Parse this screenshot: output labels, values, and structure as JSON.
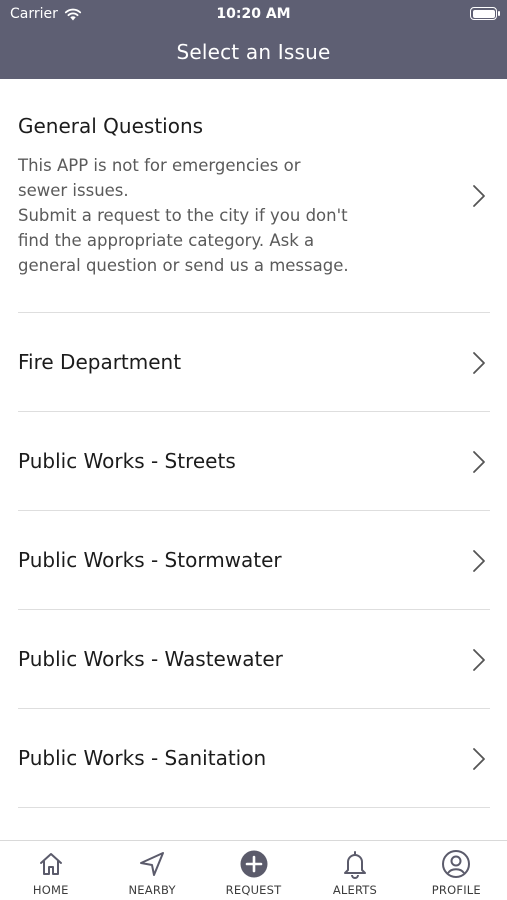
{
  "status_bar": {
    "carrier": "Carrier",
    "time": "10:20 AM"
  },
  "header": {
    "title": "Select an Issue"
  },
  "issues": [
    {
      "title": "General Questions",
      "description": "This APP is not for emergencies or\nsewer issues.\nSubmit a request to the city if you don't\nfind the appropriate category. Ask a\ngeneral question or send us a message."
    },
    {
      "title": "Fire Department"
    },
    {
      "title": "Public Works - Streets"
    },
    {
      "title": "Public Works - Stormwater"
    },
    {
      "title": "Public Works - Wastewater"
    },
    {
      "title": "Public Works - Sanitation"
    }
  ],
  "tabbar": {
    "items": [
      {
        "label": "HOME",
        "icon": "home-icon"
      },
      {
        "label": "NEARBY",
        "icon": "location-arrow-icon"
      },
      {
        "label": "REQUEST",
        "icon": "plus-circle-icon"
      },
      {
        "label": "ALERTS",
        "icon": "bell-icon"
      },
      {
        "label": "PROFILE",
        "icon": "user-circle-icon"
      }
    ]
  },
  "colors": {
    "header_bg": "#5e5f73",
    "divider": "#dedede",
    "icon": "#5b5b6b"
  }
}
